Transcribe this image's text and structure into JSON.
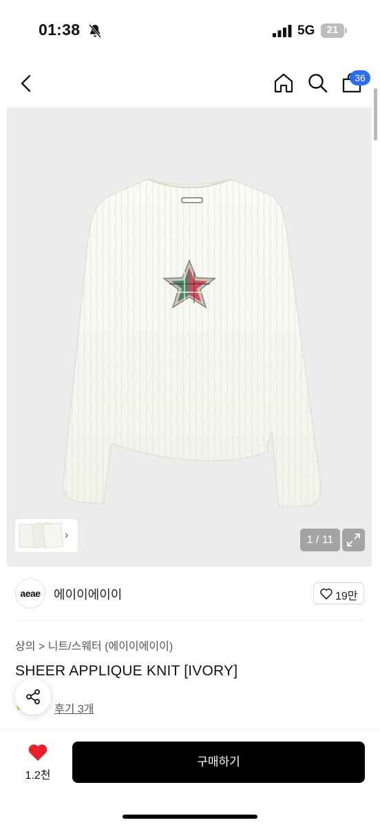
{
  "status_bar": {
    "time": "01:38",
    "network": "5G",
    "battery": "21"
  },
  "nav": {
    "cart_badge": "36",
    "icons": [
      "back-icon",
      "home-icon",
      "search-icon",
      "bag-icon"
    ]
  },
  "gallery": {
    "counter": "1 / 11"
  },
  "brand": {
    "logo_text": "aeae",
    "name": "에이이에이이",
    "like_count": "19만"
  },
  "product": {
    "breadcrumb": "상의 > 니트/스웨터 (에이이에이이)",
    "title": "SHEER APPLIQUE KNIT [IVORY]",
    "review_label": "후기 3개"
  },
  "bottom_bar": {
    "wish_count": "1.2천",
    "buy_label": "구매하기"
  },
  "colors": {
    "accent": "#2a6df4",
    "wish": "#e8202a",
    "buy_bg": "#000000"
  }
}
